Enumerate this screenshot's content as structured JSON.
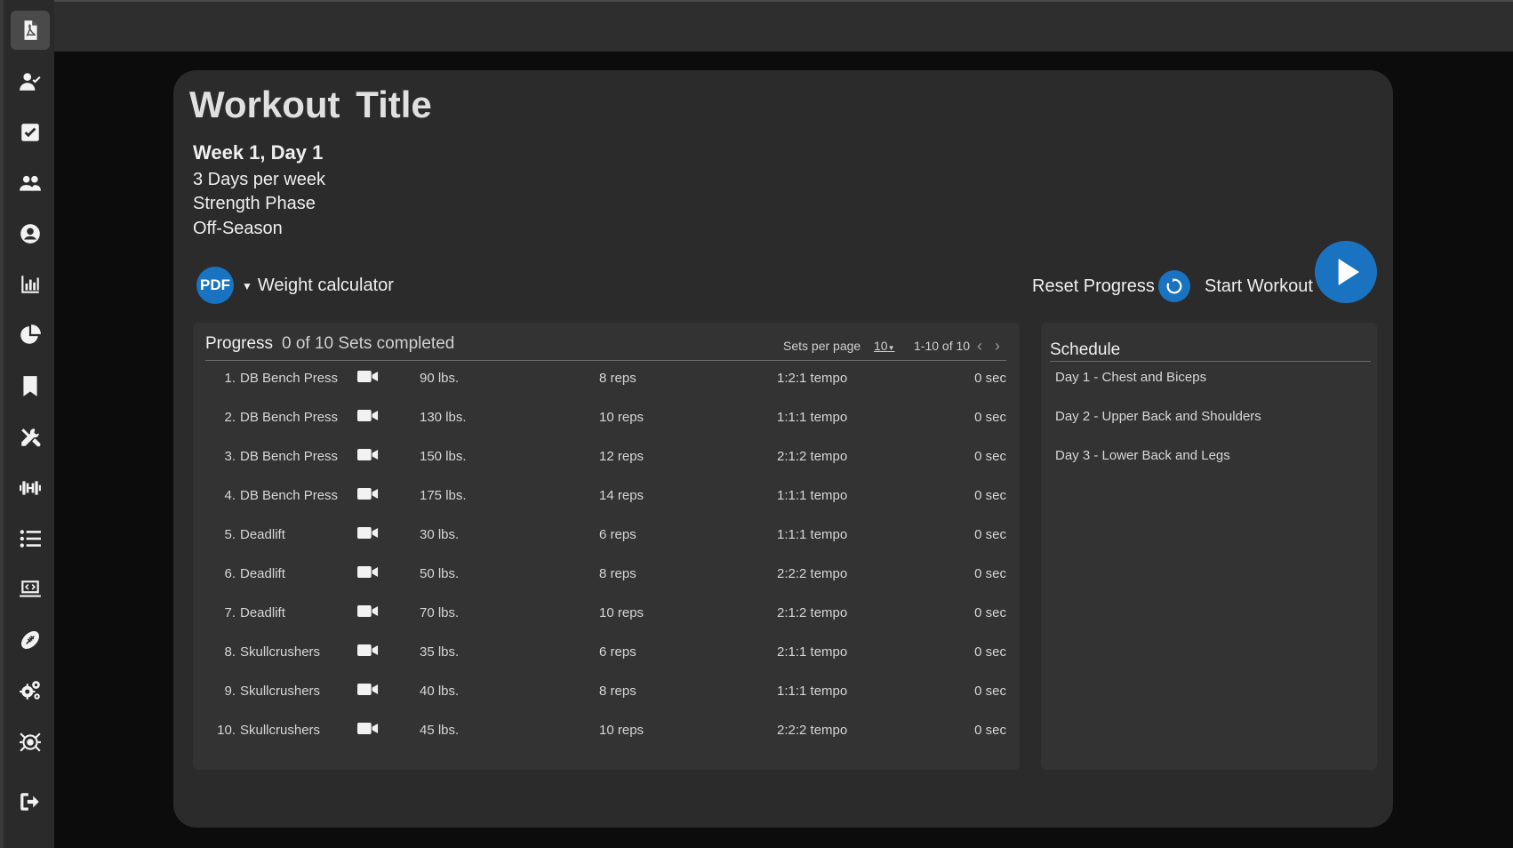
{
  "sidebar": {
    "items": [
      {
        "icon": "pdf-file-icon",
        "active": true
      },
      {
        "icon": "user-check-icon"
      },
      {
        "icon": "checkbox-icon"
      },
      {
        "icon": "users-icon"
      },
      {
        "icon": "user-circle-icon"
      },
      {
        "icon": "bar-chart-icon"
      },
      {
        "icon": "pie-chart-icon"
      },
      {
        "icon": "bookmark-icon"
      },
      {
        "icon": "tools-icon"
      },
      {
        "icon": "dumbbell-icon"
      },
      {
        "icon": "list-icon"
      },
      {
        "icon": "laptop-code-icon"
      },
      {
        "icon": "football-icon"
      },
      {
        "icon": "gears-icon"
      },
      {
        "icon": "bug-target-icon"
      },
      {
        "icon": "sign-out-icon"
      }
    ]
  },
  "workout": {
    "title": "Workout Title",
    "week_day": "Week 1, Day 1",
    "frequency": "3 Days per week",
    "phase": "Strength Phase",
    "season": "Off-Season"
  },
  "actions": {
    "pdf_label": "PDF",
    "weight_calculator": "Weight calculator",
    "reset_progress": "Reset Progress",
    "start_workout": "Start Workout"
  },
  "progress": {
    "title": "Progress",
    "completed": "0 of 10 Sets completed",
    "sets_per_page_label": "Sets per page",
    "sets_per_page_value": "10",
    "range": "1-10 of 10",
    "rows": [
      {
        "num": "1.",
        "name": "DB Bench Press",
        "weight": "90 lbs.",
        "reps": "8 reps",
        "tempo": "1:2:1 tempo",
        "rest": "0 sec"
      },
      {
        "num": "2.",
        "name": "DB Bench Press",
        "weight": "130 lbs.",
        "reps": "10 reps",
        "tempo": "1:1:1 tempo",
        "rest": "0 sec"
      },
      {
        "num": "3.",
        "name": "DB Bench Press",
        "weight": "150 lbs.",
        "reps": "12 reps",
        "tempo": "2:1:2 tempo",
        "rest": "0 sec"
      },
      {
        "num": "4.",
        "name": "DB Bench Press",
        "weight": "175 lbs.",
        "reps": "14 reps",
        "tempo": "1:1:1 tempo",
        "rest": "0 sec"
      },
      {
        "num": "5.",
        "name": "Deadlift",
        "weight": "30 lbs.",
        "reps": "6 reps",
        "tempo": "1:1:1 tempo",
        "rest": "0 sec"
      },
      {
        "num": "6.",
        "name": "Deadlift",
        "weight": "50 lbs.",
        "reps": "8 reps",
        "tempo": "2:2:2 tempo",
        "rest": "0 sec"
      },
      {
        "num": "7.",
        "name": "Deadlift",
        "weight": "70 lbs.",
        "reps": "10 reps",
        "tempo": "2:1:2 tempo",
        "rest": "0 sec"
      },
      {
        "num": "8.",
        "name": "Skullcrushers",
        "weight": "35 lbs.",
        "reps": "6 reps",
        "tempo": "2:1:1 tempo",
        "rest": "0 sec"
      },
      {
        "num": "9.",
        "name": "Skullcrushers",
        "weight": "40 lbs.",
        "reps": "8 reps",
        "tempo": "1:1:1 tempo",
        "rest": "0 sec"
      },
      {
        "num": "10.",
        "name": "Skullcrushers",
        "weight": "45 lbs.",
        "reps": "10 reps",
        "tempo": "2:2:2 tempo",
        "rest": "0 sec"
      }
    ]
  },
  "schedule": {
    "title": "Schedule",
    "days": [
      "Day 1 - Chest and Biceps",
      "Day 2 - Upper Back and Shoulders",
      "Day 3 - Lower Back and Legs"
    ]
  },
  "colors": {
    "accent": "#1a73c0",
    "panel": "#333333",
    "card": "#2b2b2b",
    "background": "#0c0c0c"
  }
}
